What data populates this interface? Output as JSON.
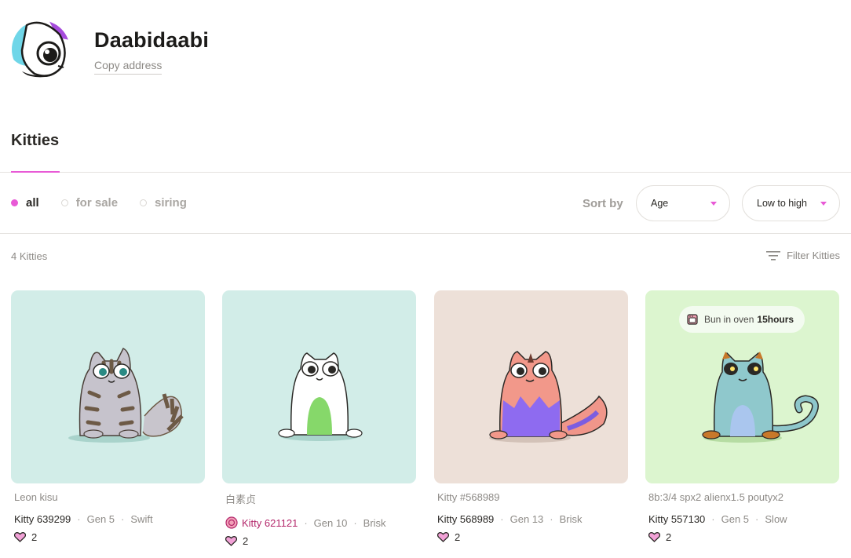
{
  "profile": {
    "name": "Daabidaabi",
    "copy_address": "Copy address"
  },
  "section_tab": "Kitties",
  "filters": [
    {
      "label": "all",
      "active": true
    },
    {
      "label": "for sale",
      "active": false
    },
    {
      "label": "siring",
      "active": false
    }
  ],
  "sort": {
    "label": "Sort by",
    "field": "Age",
    "order": "Low to high"
  },
  "count_label": "4 Kitties",
  "filter_button": "Filter Kitties",
  "colors": {
    "accent": "#e85ad6",
    "card_teal": "#d2ede8",
    "card_peach": "#ede0d8",
    "card_green": "#dcf5cf"
  },
  "kitties": [
    {
      "name": "Leon kisu",
      "id": "Kitty 639299",
      "gen": "Gen 5",
      "speed": "Swift",
      "likes": "2"
    },
    {
      "name": "白素贞",
      "id": "Kitty 621121",
      "gen": "Gen 10",
      "speed": "Brisk",
      "likes": "2"
    },
    {
      "name": "Kitty #568989",
      "id": "Kitty 568989",
      "gen": "Gen 13",
      "speed": "Brisk",
      "likes": "2"
    },
    {
      "name": "8b:3/4 spx2 alienx1.5 poutyx2",
      "id": "Kitty 557130",
      "gen": "Gen 5",
      "speed": "Slow",
      "likes": "2"
    }
  ],
  "bun": {
    "text": "Bun in oven",
    "time": "15hours",
    "icon": "oven-icon"
  }
}
